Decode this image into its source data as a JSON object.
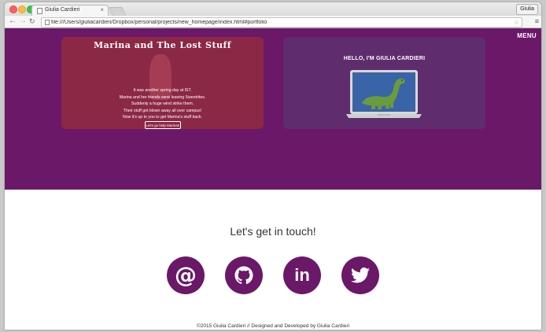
{
  "browser": {
    "tab_title": "Giulia Cardieri",
    "profile_name": "Giulia",
    "url": "file:///Users/giuliacardieri/Dropbox/personal/projects/new_homepage/index.html#portfolio"
  },
  "nav": {
    "menu_label": "MENU"
  },
  "portfolio": {
    "game_card": {
      "title": "Marina and The Lost Stuff",
      "story": [
        "It was another spring day at IST.",
        "Marina and her friends were leaving Sweetrites.",
        "Suddenly a huge wind strike them.",
        "Their stuff got blown away all over campus!",
        "Now it's up to you to get Marina's stuff back."
      ],
      "button_label": "Let's go help Marina!!"
    },
    "dino_card": {
      "title": "HELLO, I'M GIULIA CARDIERI"
    }
  },
  "contact": {
    "heading": "Let's get in touch!",
    "links": [
      {
        "name": "email",
        "icon": "at-sign-icon"
      },
      {
        "name": "github",
        "icon": "github-icon"
      },
      {
        "name": "linkedin",
        "icon": "linkedin-icon"
      },
      {
        "name": "twitter",
        "icon": "twitter-icon"
      }
    ]
  },
  "footer": {
    "text": "©2015 Giulia Cardieri // Designed and Developed by Giulia Cardieri"
  },
  "colors": {
    "brand_purple": "#6b1869",
    "game_card": "#8b2845",
    "dino_card": "#5f2c6d",
    "dino_green": "#6a9c3d",
    "screen_blue": "#3a64a8"
  }
}
